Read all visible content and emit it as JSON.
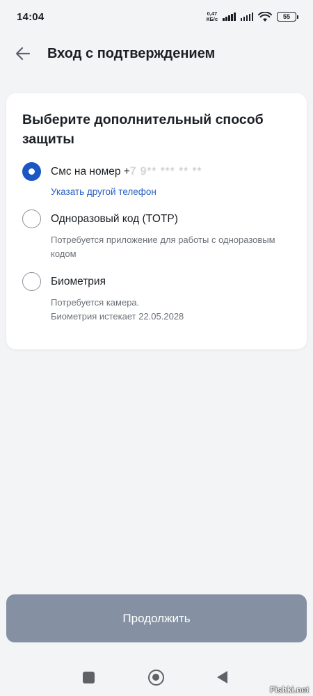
{
  "status_bar": {
    "time": "14:04",
    "net_speed_value": "0,47",
    "net_speed_unit": "КБ/с",
    "battery": "55",
    "icons": [
      "signal-icon",
      "signal-icon",
      "wifi-icon",
      "battery-icon"
    ]
  },
  "header": {
    "back_icon": "arrow-left-icon",
    "title": "Вход с подтверждением"
  },
  "card": {
    "title": "Выберите дополнительный способ защиты",
    "options": [
      {
        "label": "Смс на номер +",
        "masked_number": "7 9** *** ** **",
        "selected": true,
        "link": "Указать другой телефон"
      },
      {
        "label": "Одноразовый код (TOTP)",
        "selected": false,
        "description": "Потребуется приложение для работы с одноразовым кодом"
      },
      {
        "label": "Биометрия",
        "selected": false,
        "description_line1": "Потребуется камера.",
        "description_line2": "Биометрия истекает 22.05.2028"
      }
    ]
  },
  "continue_button": {
    "label": "Продолжить",
    "color": "#8591a3"
  },
  "nav_bar": {
    "icons": [
      "recent-apps-icon",
      "home-icon",
      "back-icon"
    ]
  },
  "watermark": "Fishki.net",
  "colors": {
    "accent": "#1a56c4",
    "link": "#2a62c0",
    "background": "#f3f4f6"
  }
}
